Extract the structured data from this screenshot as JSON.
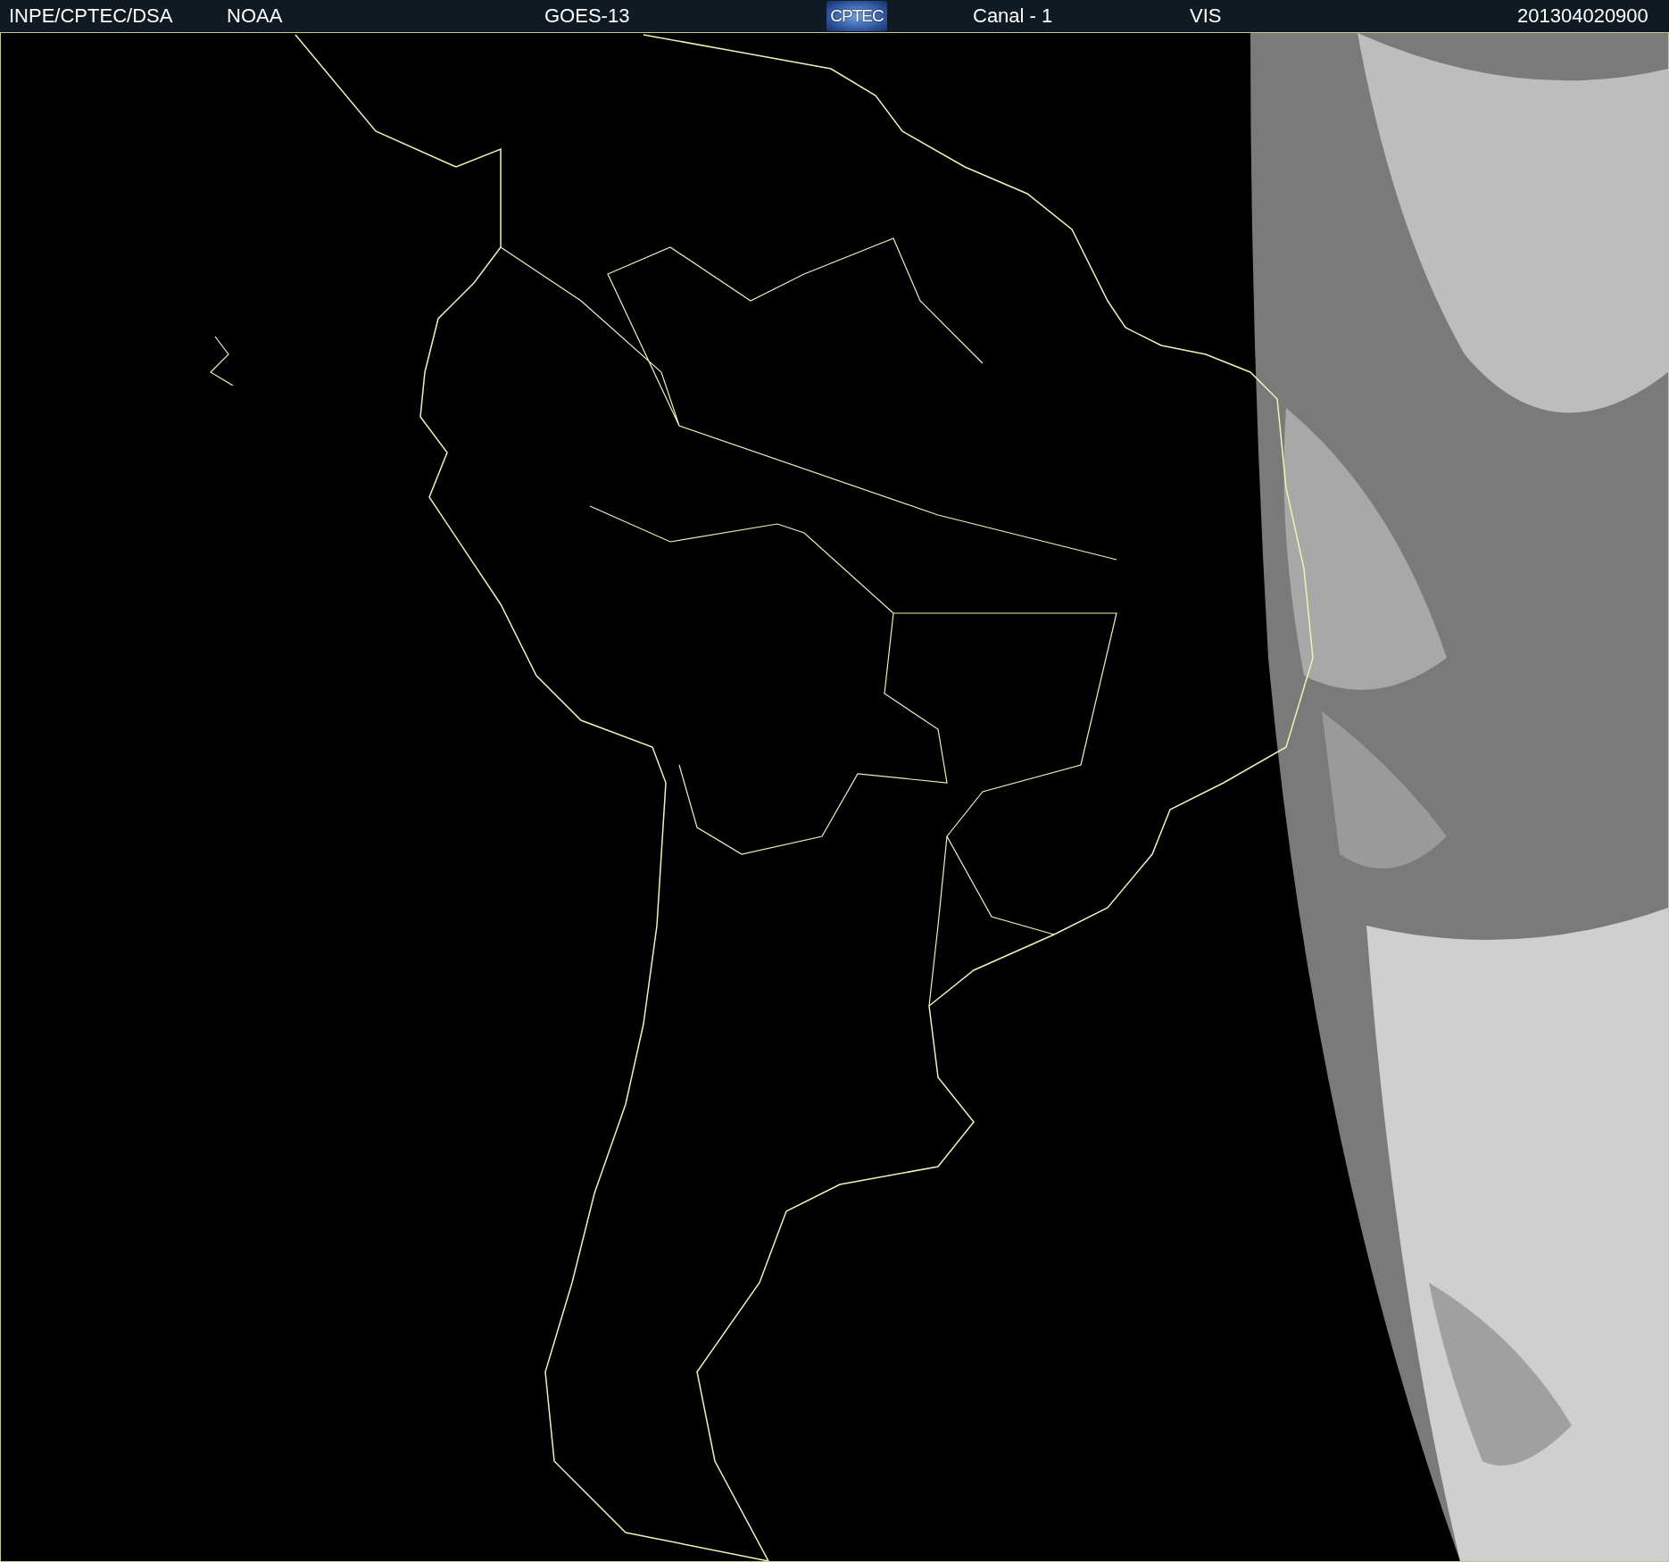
{
  "header": {
    "agency": "INPE/CPTEC/DSA",
    "source": "NOAA",
    "satellite": "GOES-13",
    "logo": "CPTEC",
    "channel": "Canal - 1",
    "band": "VIS",
    "timestamp": "201304020900"
  }
}
